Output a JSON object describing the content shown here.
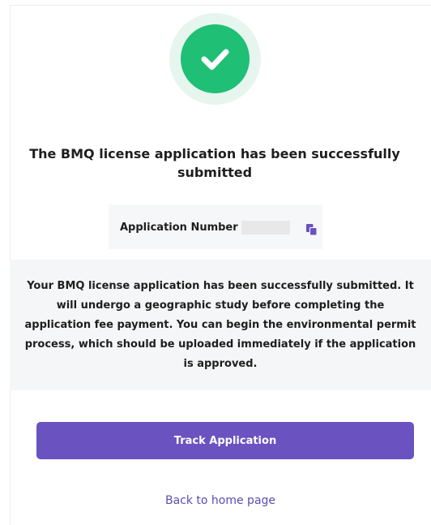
{
  "status": {
    "icon": "check-icon",
    "title": "The BMQ license application has been successfully submitted"
  },
  "application_number": {
    "label": "Application Number",
    "value": "",
    "copy_icon": "copy-icon"
  },
  "message": "Your BMQ license application has been successfully submitted. It will undergo a geographic study before completing the application fee payment. You can begin the environmental permit process, which should be uploaded immediately if the application is approved.",
  "actions": {
    "track_label": "Track Application",
    "home_label": "Back to home page"
  },
  "colors": {
    "success": "#1fbf75",
    "success_ring": "#e6f6ee",
    "primary": "#6a52c1",
    "link": "#5b4db5"
  }
}
